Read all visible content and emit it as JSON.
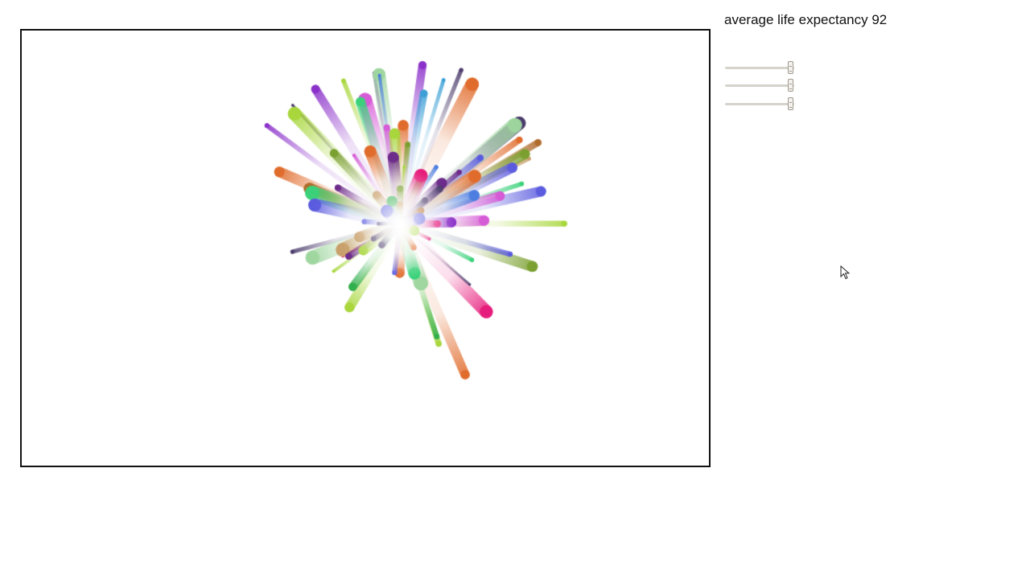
{
  "header": {
    "life_expectancy_label": "average life expectancy 92"
  },
  "sliders": [
    {
      "name": "slider-1",
      "value_fraction": 0.96
    },
    {
      "name": "slider-2",
      "value_fraction": 0.96
    },
    {
      "name": "slider-3",
      "value_fraction": 0.96
    }
  ],
  "visualization": {
    "type": "particle-burst",
    "particle_count": 90,
    "palette": [
      "#e6197a",
      "#3ad17a",
      "#8a2fc9",
      "#a7d63a",
      "#4a7de0",
      "#b06a2a",
      "#6b2a8a",
      "#2fae4a",
      "#c9a06a",
      "#5a5adf",
      "#e06a2a",
      "#7aa02f",
      "#d65ad6",
      "#3a9fd6",
      "#4a3a6a",
      "#9fd69f"
    ]
  },
  "cursor": {
    "icon": "arrow-cursor-icon"
  }
}
